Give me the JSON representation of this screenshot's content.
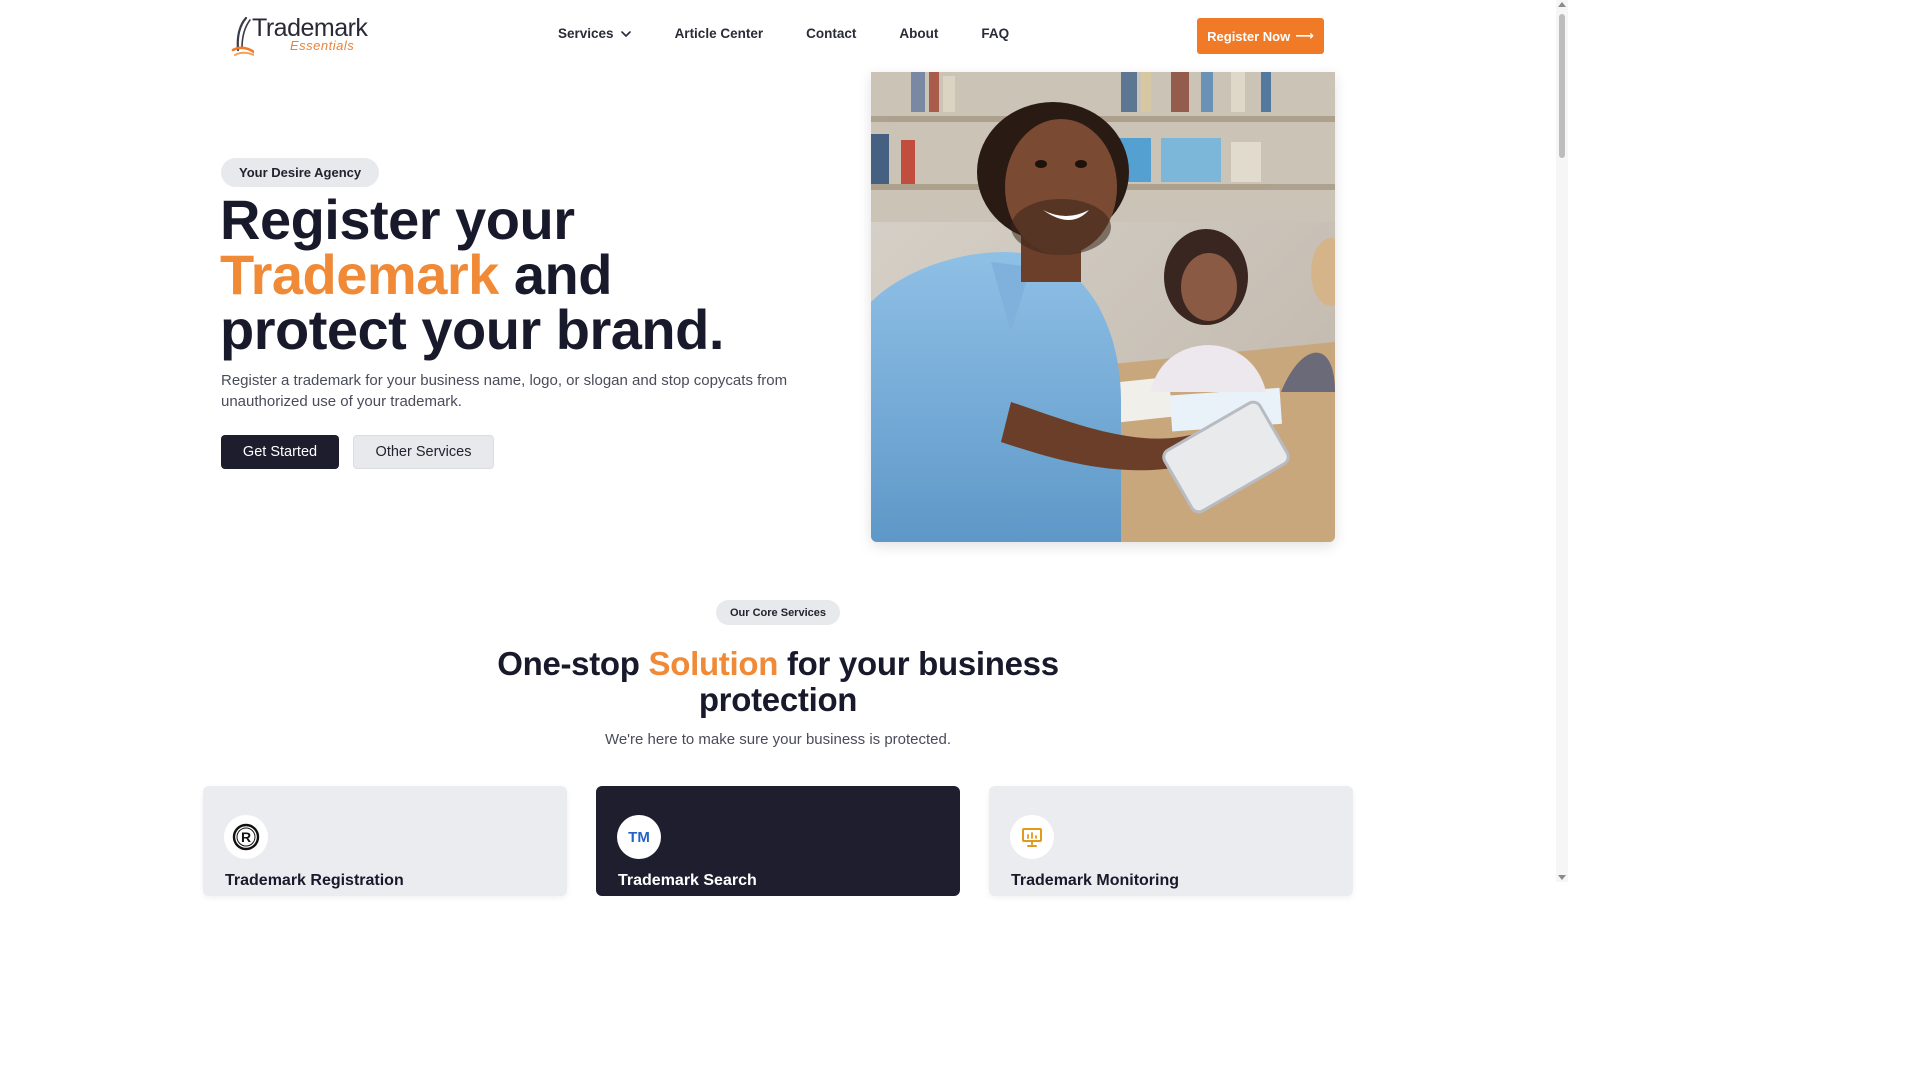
{
  "brand": {
    "logo_word": "Trademark",
    "logo_sub": "Essentials",
    "accent_color": "#f07a26",
    "dark_color": "#1f1e2f"
  },
  "nav": {
    "items": [
      {
        "label": "Services",
        "has_dropdown": true
      },
      {
        "label": "Article Center"
      },
      {
        "label": "Contact"
      },
      {
        "label": "About"
      },
      {
        "label": "FAQ"
      }
    ],
    "cta_label": "Register Now",
    "cta_icon": "arrow-right-icon"
  },
  "hero": {
    "badge": "Your Desire Agency",
    "title_line1": "Register your",
    "title_accent": "Trademark",
    "title_line2_rest": " and",
    "title_line3": "protect your brand.",
    "subtitle": "Register a trademark for your business name, logo, or slogan and stop copycats from unauthorized use of your trademark.",
    "primary_button": "Get Started",
    "secondary_button": "Other Services"
  },
  "services": {
    "badge": "Our Core Services",
    "title_pre": "One-stop ",
    "title_accent": "Solution",
    "title_post": " for your business protection",
    "subtitle": "We're here to make sure your business is protected.",
    "cards": [
      {
        "title": "Trademark Registration",
        "icon": "registered-icon",
        "theme": "light"
      },
      {
        "title": "Trademark Search",
        "icon": "tm-icon",
        "icon_text": "TM",
        "theme": "dark"
      },
      {
        "title": "Trademark Monitoring",
        "icon": "monitor-presentation-icon",
        "theme": "light"
      }
    ]
  }
}
